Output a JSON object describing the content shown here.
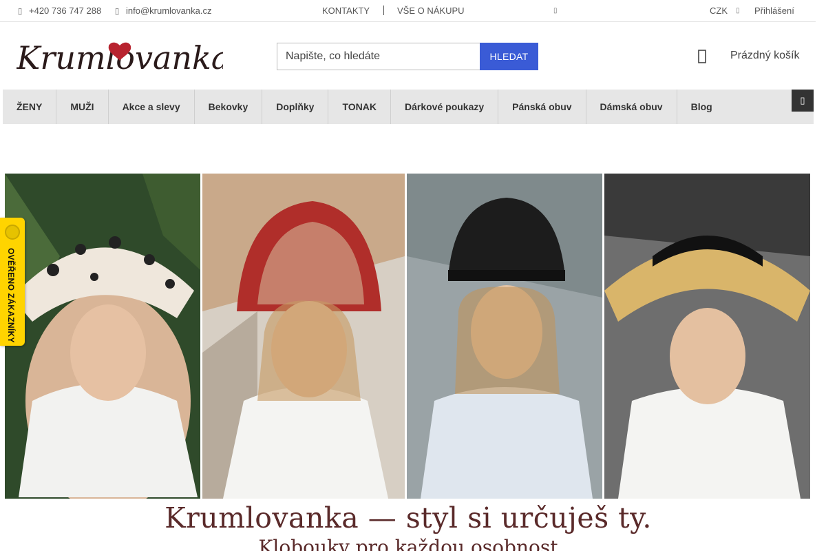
{
  "topbar": {
    "phone": "+420 736 747 288",
    "email": "info@krumlovanka.cz",
    "links": [
      "KONTAKTY",
      "VŠE O NÁKUPU"
    ],
    "currency": "CZK",
    "login": "Přihlášení"
  },
  "header": {
    "logo_text": "Krumlovanka",
    "search_placeholder": "Napište, co hledáte",
    "search_button": "HLEDAT",
    "cart_label": "Prázdný košík"
  },
  "nav": {
    "items": [
      "ŽENY",
      "MUŽI",
      "Akce a slevy",
      "Bekovky",
      "Doplňky",
      "TONAK",
      "Dárkové poukazy",
      "Pánská obuv",
      "Dámská obuv",
      "Blog"
    ]
  },
  "banner": {
    "title": "Krumlovanka — styl si určuješ ty.",
    "subtitle": "Klobouky pro každou osobnost"
  },
  "badge": {
    "label": "OVĚŘENO ZÁKAZNÍKY"
  },
  "colors": {
    "accent": "#3a5bd6",
    "brand": "#5a2a2a",
    "nav_bg": "#e6e6e6",
    "badge": "#ffd400"
  },
  "icons": [
    "phone-icon",
    "mail-icon",
    "chevron-down-icon",
    "cart-icon",
    "menu-toggle-icon"
  ]
}
